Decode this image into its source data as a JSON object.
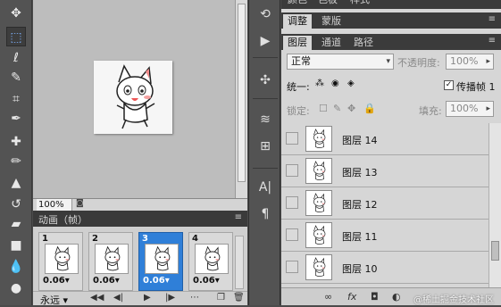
{
  "toolbar": {
    "tools": [
      "move-icon",
      "rect-marquee-icon",
      "lasso-icon",
      "quick-select-icon",
      "crop-icon",
      "eyedropper-icon",
      "healing-brush-icon",
      "brush-icon",
      "clone-stamp-icon",
      "history-brush-icon",
      "eraser-icon",
      "gradient-icon",
      "blur-icon",
      "dodge-icon"
    ]
  },
  "canvas": {
    "zoom": "100%"
  },
  "animation": {
    "panel_title": "动画（帧）",
    "frames": [
      {
        "num": "1",
        "delay": "0.06"
      },
      {
        "num": "2",
        "delay": "0.06"
      },
      {
        "num": "3",
        "delay": "0.06"
      },
      {
        "num": "4",
        "delay": "0.06"
      }
    ],
    "selected_frame": 3,
    "loop": "永远"
  },
  "panels": {
    "top_tabs": [
      "颜色",
      "色板",
      "样式"
    ],
    "adjust_tabs": [
      "调整",
      "蒙版"
    ],
    "layer_tabs": [
      "图层",
      "通道",
      "路径"
    ],
    "blend_mode": "正常",
    "opacity_label": "不透明度:",
    "opacity_value": "100%",
    "unify_label": "统一:",
    "propagate_label": "传播帧 1",
    "lock_label": "锁定:",
    "fill_label": "填充:",
    "fill_value": "100%",
    "layers": [
      {
        "name": "图层 14"
      },
      {
        "name": "图层 13"
      },
      {
        "name": "图层 12"
      },
      {
        "name": "图层 11"
      },
      {
        "name": "图层 10"
      }
    ],
    "watermark": "@稀土掘金技术社区"
  }
}
